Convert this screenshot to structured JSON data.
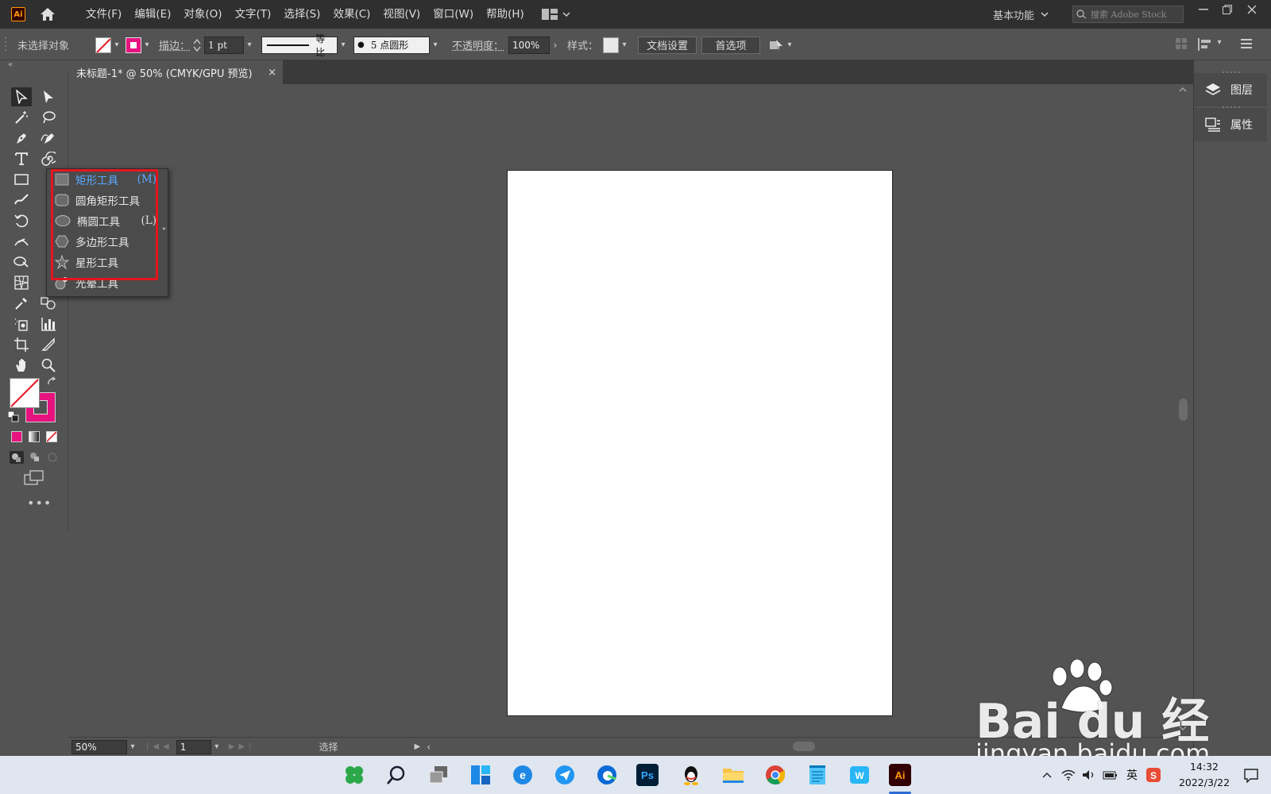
{
  "menubar": {
    "logo": "Ai",
    "menus": [
      "文件(F)",
      "编辑(E)",
      "对象(O)",
      "文字(T)",
      "选择(S)",
      "效果(C)",
      "视图(V)",
      "窗口(W)",
      "帮助(H)"
    ],
    "workspace": "基本功能",
    "search_placeholder": "搜索 Adobe Stock"
  },
  "controlbar": {
    "selection_status": "未选择对象",
    "stroke_label": "描边：",
    "stroke_value": "1 pt",
    "stroke_profile": "等比",
    "brush": "5 点圆形",
    "opacity_label": "不透明度：",
    "opacity_value": "100%",
    "style_label": "样式：",
    "doc_setup": "文档设置",
    "preferences": "首选项",
    "fill_color": "#e6137f"
  },
  "document": {
    "tab_title": "未标题-1* @ 50% (CMYK/GPU 预览)",
    "close": "×"
  },
  "flyout": {
    "items": [
      {
        "label": "矩形工具",
        "shortcut": "(M)",
        "icon": "rectangle-icon"
      },
      {
        "label": "圆角矩形工具",
        "shortcut": "",
        "icon": "rounded-rectangle-icon"
      },
      {
        "label": "椭圆工具",
        "shortcut": "(L)",
        "icon": "ellipse-icon"
      },
      {
        "label": "多边形工具",
        "shortcut": "",
        "icon": "polygon-icon"
      },
      {
        "label": "星形工具",
        "shortcut": "",
        "icon": "star-icon"
      },
      {
        "label": "光晕工具",
        "shortcut": "",
        "icon": "flare-icon"
      }
    ],
    "highlight_color": "#e4151f"
  },
  "status": {
    "zoom": "50%",
    "page": "1",
    "tool": "选择"
  },
  "rightpanel": {
    "layers": "图层",
    "properties": "属性"
  },
  "watermark": {
    "text": "Bai du 经验",
    "url": "jingyan.baidu.com"
  },
  "taskbar": {
    "ime": "英",
    "time": "14:32",
    "date": "2022/3/22"
  }
}
